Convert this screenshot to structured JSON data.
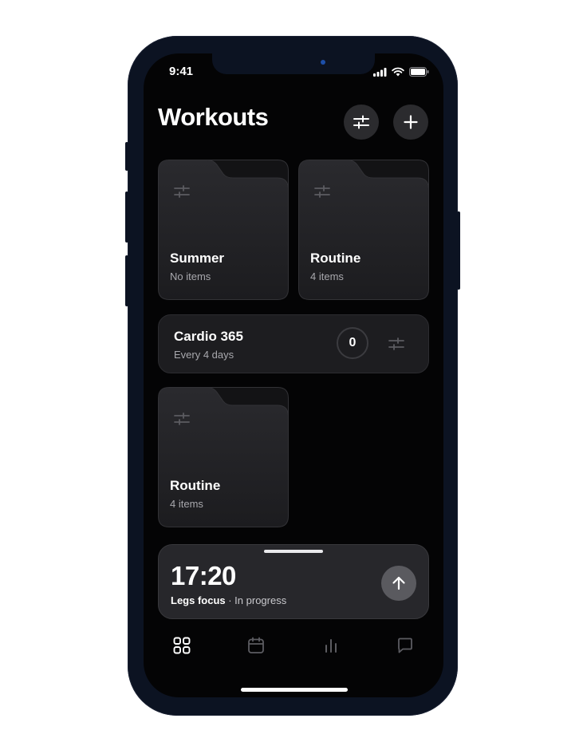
{
  "status_bar": {
    "time": "9:41"
  },
  "header": {
    "title": "Workouts"
  },
  "folders": [
    {
      "name": "Summer",
      "subtitle": "No items"
    },
    {
      "name": "Routine",
      "subtitle": "4 items"
    },
    {
      "name": "Routine",
      "subtitle": "4 items"
    }
  ],
  "cardio": {
    "name": "Cardio 365",
    "subtitle": "Every 4 days",
    "count": "0"
  },
  "now_playing": {
    "time": "17:20",
    "focus": "Legs focus",
    "status": " · In progress"
  },
  "tabs": [
    {
      "icon": "grid-icon",
      "active": true
    },
    {
      "icon": "calendar-icon",
      "active": false
    },
    {
      "icon": "stats-icon",
      "active": false
    },
    {
      "icon": "chat-icon",
      "active": false
    }
  ],
  "colors": {
    "background": "#040405",
    "card": "#1d1d20",
    "frame": "#0c1322",
    "muted_text": "#a8a8ad"
  }
}
